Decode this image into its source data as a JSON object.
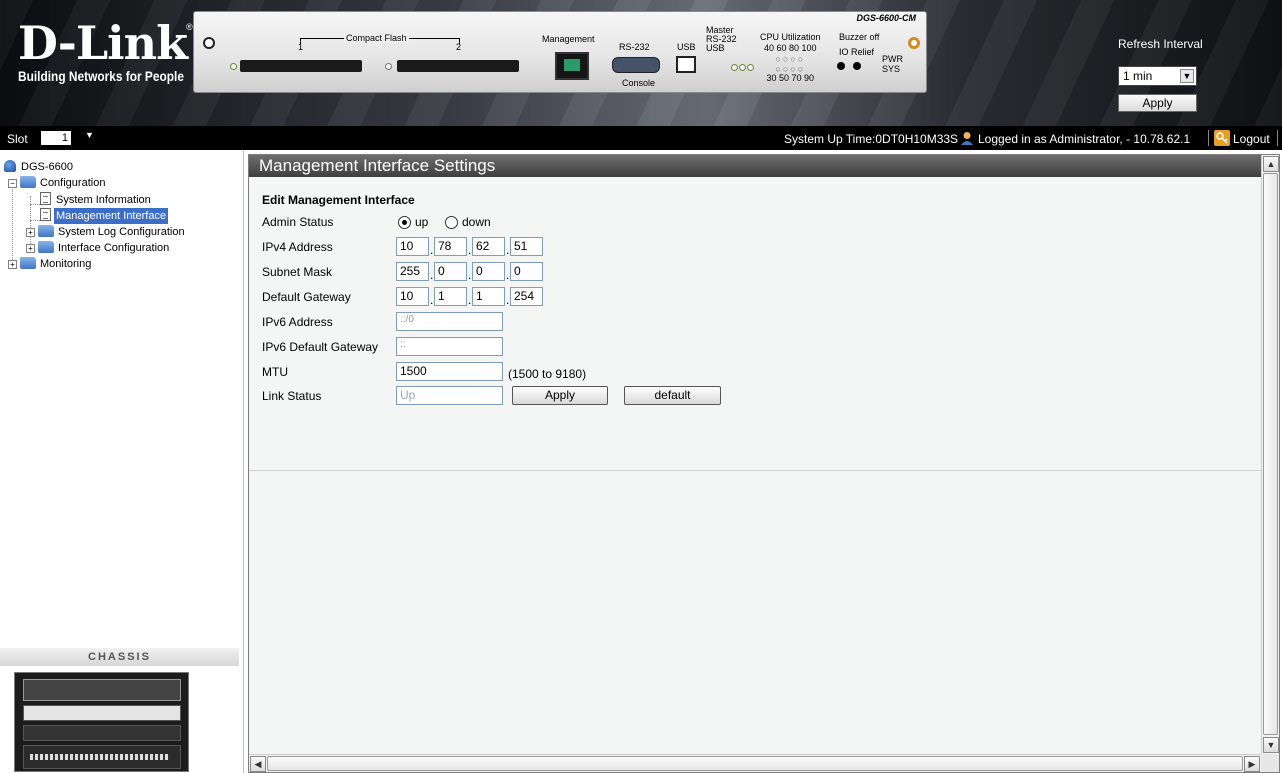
{
  "header": {
    "logo_word": "D-Link",
    "logo_reg": "®",
    "logo_tagline": "Building Networks for People",
    "device_model": "DGS-6600-CM",
    "compact_flash_label": "Compact Flash",
    "cf_slot_1": "1",
    "cf_slot_2": "2",
    "management_label": "Management",
    "rs232_label": "RS-232",
    "console_label": "Console",
    "usb_label": "USB",
    "master_lines": [
      "Master",
      "RS-232",
      "USB"
    ],
    "cpu_label": "CPU Utilization",
    "cpu_top": "40 60 80 100",
    "cpu_bottom": "30 50 70 90",
    "buzzer_label": "Buzzer off",
    "io_relief_label": "IO Relief",
    "pwr_label": "PWR",
    "sys_label": "SYS",
    "refresh_label": "Refresh Interval",
    "refresh_value": "1 min",
    "refresh_apply": "Apply"
  },
  "statusbar": {
    "slot_label": "Slot",
    "slot_value": "1",
    "uptime": "System Up Time:0DT0H10M33S",
    "logged_in": "Logged in as Administrator, - 10.78.62.1",
    "logout": "Logout"
  },
  "tree": {
    "root": "DGS-6600",
    "configuration": "Configuration",
    "system_information": "System Information",
    "management_interface": "Management Interface",
    "system_log_configuration": "System Log Configuration",
    "interface_configuration": "Interface Configuration",
    "monitoring": "Monitoring"
  },
  "chassis_label": "CHASSIS",
  "main": {
    "title": "Management Interface Settings",
    "section_title": "Edit Management Interface",
    "admin_status_label": "Admin Status",
    "admin_status_up": "up",
    "admin_status_down": "down",
    "admin_status_selected": "up",
    "ipv4_label": "IPv4 Address",
    "ipv4": [
      "10",
      "78",
      "62",
      "51"
    ],
    "subnet_label": "Subnet Mask",
    "subnet": [
      "255",
      "0",
      "0",
      "0"
    ],
    "gateway_label": "Default Gateway",
    "gateway": [
      "10",
      "1",
      "1",
      "254"
    ],
    "ipv6_label": "IPv6 Address",
    "ipv6_value": "::/0",
    "ipv6_gw_label": "IPv6 Default Gateway",
    "ipv6_gw_value": "::",
    "mtu_label": "MTU",
    "mtu_value": "1500",
    "mtu_range": "(1500 to 9180)",
    "link_status_label": "Link Status",
    "link_status_value": "Up",
    "apply_button": "Apply",
    "default_button": "default"
  }
}
